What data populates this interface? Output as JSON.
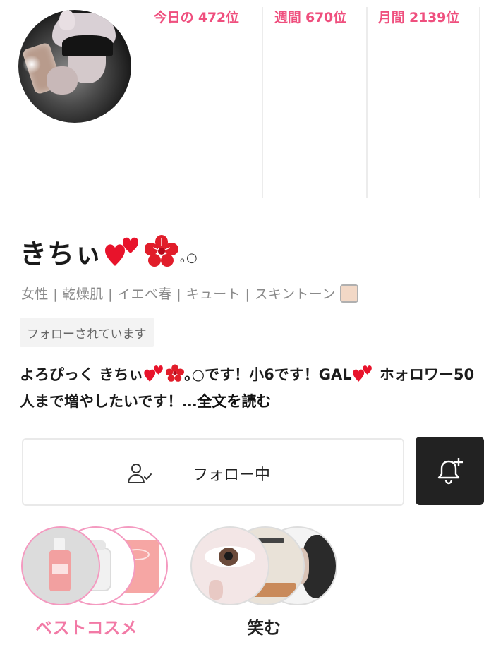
{
  "ranking": {
    "today": "今日の 472位",
    "week": "週間 670位",
    "month": "月間 2139位",
    "color": "#ef4f7e"
  },
  "profile": {
    "name": "きちぃ",
    "dots": "｡○",
    "tags": "女性 | 乾燥肌 | イエベ春 | キュート | スキントーン",
    "skin_tone_color": "#f2d8c6",
    "follow_status": "フォローされています",
    "bio_part1": "よろぴっく きちぃ",
    "bio_part2": "｡○です！小6です！GAL",
    "bio_part3": " ホォロワー50人まで増やしたいです！…",
    "bio_more": "全文を読む"
  },
  "actions": {
    "follow_label": "フォロー中",
    "follow_icon": "user-check-icon",
    "bell_icon": "bell-plus-icon"
  },
  "collections": [
    {
      "title": "ベストコスメ",
      "color": "#f27aa6"
    },
    {
      "title": "笑む",
      "color": "#222222"
    }
  ]
}
